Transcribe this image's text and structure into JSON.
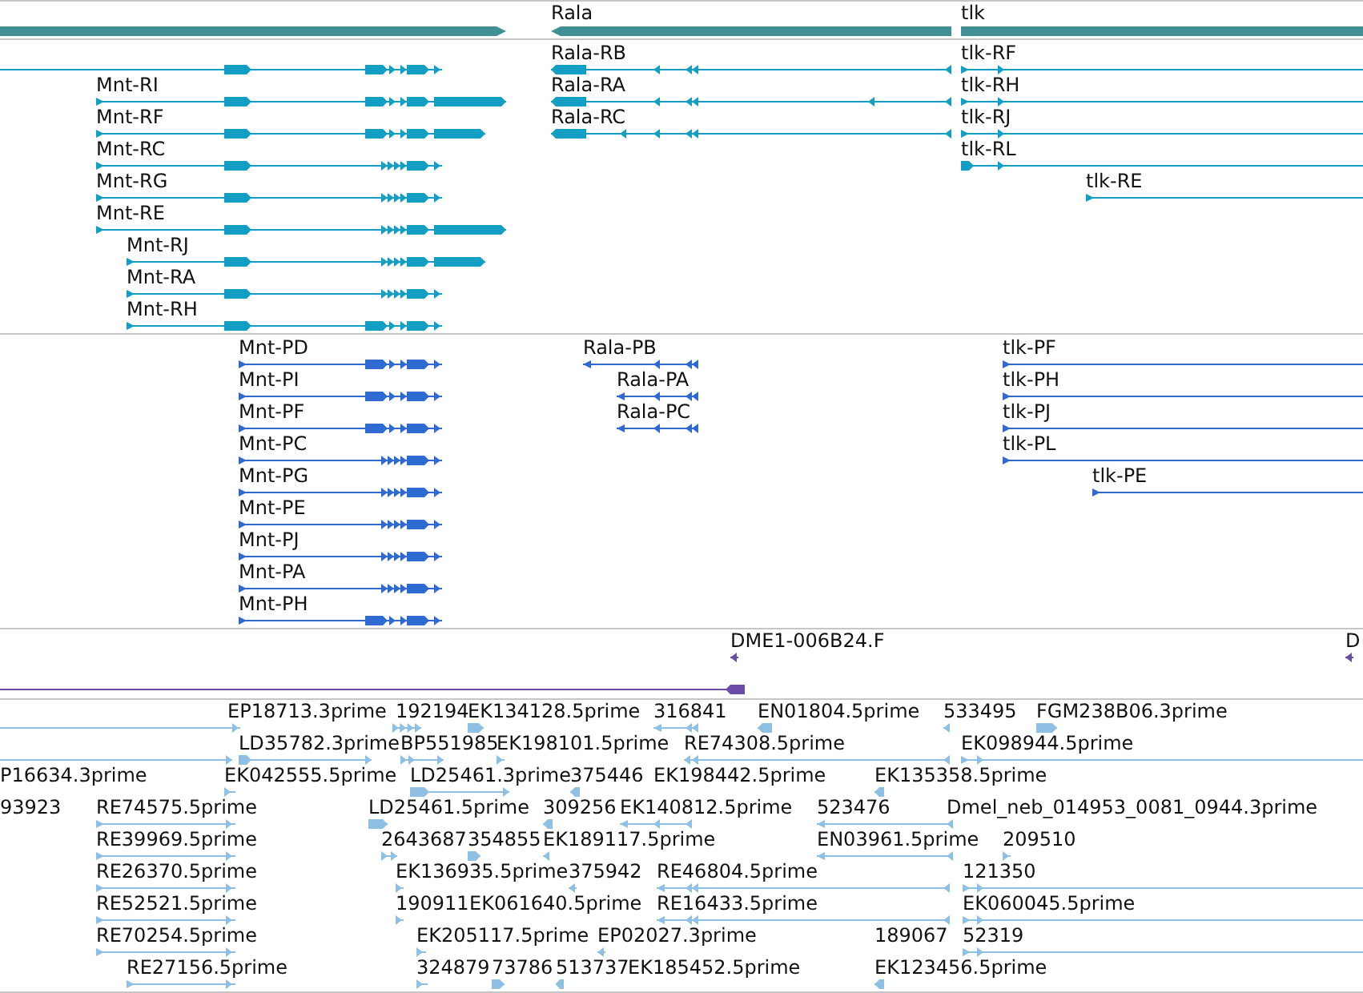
{
  "tracks": [
    {
      "kind": "genes",
      "features": [
        {
          "reverse": false
        },
        {
          "label": "Rala",
          "reverse": true
        },
        {
          "label": "tlk"
        }
      ]
    },
    {
      "kind": "transcripts",
      "features": [
        {
          "reverse": false
        },
        {
          "label": "Rala-RB",
          "reverse": true
        },
        {
          "label": "tlk-RF",
          "reverse": false
        },
        {
          "label": "Mnt-RI",
          "reverse": false
        },
        {
          "label": "Rala-RA",
          "reverse": true
        },
        {
          "label": "tlk-RH",
          "reverse": false
        },
        {
          "label": "Mnt-RF",
          "reverse": false
        },
        {
          "label": "Rala-RC",
          "reverse": true
        },
        {
          "label": "tlk-RJ",
          "reverse": false
        },
        {
          "label": "Mnt-RC",
          "reverse": false
        },
        {
          "label": "tlk-RL",
          "reverse": false
        },
        {
          "label": "Mnt-RG",
          "reverse": false
        },
        {
          "label": "tlk-RE",
          "reverse": false
        },
        {
          "label": "Mnt-RE",
          "reverse": false
        },
        {
          "label": "Mnt-RJ",
          "reverse": false
        },
        {
          "label": "Mnt-RA",
          "reverse": false
        },
        {
          "label": "Mnt-RH",
          "reverse": false
        }
      ]
    },
    {
      "kind": "proteins",
      "features": [
        {
          "label": "Mnt-PD",
          "reverse": false
        },
        {
          "label": "Rala-PB",
          "reverse": true
        },
        {
          "label": "tlk-PF",
          "reverse": false
        },
        {
          "label": "Mnt-PI",
          "reverse": false
        },
        {
          "label": "Rala-PA",
          "reverse": true
        },
        {
          "label": "tlk-PH",
          "reverse": false
        },
        {
          "label": "Mnt-PF",
          "reverse": false
        },
        {
          "label": "Rala-PC",
          "reverse": true
        },
        {
          "label": "tlk-PJ",
          "reverse": false
        },
        {
          "label": "Mnt-PC",
          "reverse": false
        },
        {
          "label": "tlk-PL",
          "reverse": false
        },
        {
          "label": "Mnt-PG",
          "reverse": false
        },
        {
          "label": "tlk-PE",
          "reverse": false
        },
        {
          "label": "Mnt-PE",
          "reverse": false
        },
        {
          "label": "Mnt-PJ",
          "reverse": false
        },
        {
          "label": "Mnt-PA",
          "reverse": false
        },
        {
          "label": "Mnt-PH",
          "reverse": false
        }
      ]
    },
    {
      "kind": "clones",
      "features": [
        {
          "label": "DME1-006B24.F",
          "reverse": true
        },
        {
          "label": "D",
          "reverse": true
        },
        {
          "reverse": true
        }
      ]
    },
    {
      "kind": "ests",
      "features": [
        {
          "reverse": false
        },
        {
          "label": "EP18713.3prime"
        },
        {
          "label": "192194",
          "reverse": false
        },
        {
          "label": "EK134128.5prime",
          "reverse": false
        },
        {
          "label": "316841",
          "reverse": true
        },
        {
          "label": "EN01804.5prime",
          "reverse": true
        },
        {
          "label": "533495",
          "reverse": true
        },
        {
          "label": "FGM238B06.3prime",
          "reverse": false
        },
        {
          "reverse": false
        },
        {
          "label": "LD35782.3prime",
          "reverse": false
        },
        {
          "label": "BP551985",
          "reverse": false
        },
        {
          "label": "EK198101.5prime",
          "reverse": false
        },
        {
          "label": "RE74308.5prime",
          "reverse": true
        },
        {
          "label": "EK098944.5prime",
          "reverse": false
        },
        {
          "label": "P16634.3prime"
        },
        {
          "label": "EK042555.5prime",
          "reverse": false
        },
        {
          "label": "LD25461.3prime",
          "reverse": false
        },
        {
          "label": "375446",
          "reverse": true
        },
        {
          "label": "EK198442.5prime"
        },
        {
          "label": "EK135358.5prime",
          "reverse": true
        },
        {
          "label": "93923"
        },
        {
          "label": "RE74575.5prime",
          "reverse": false
        },
        {
          "label": "LD25461.5prime",
          "reverse": false
        },
        {
          "label": "309256",
          "reverse": true
        },
        {
          "label": "EK140812.5prime",
          "reverse": true
        },
        {
          "label": "523476",
          "reverse": true
        },
        {
          "label": "Dmel_neb_014953_0081_0944.3prime"
        },
        {
          "label": "RE39969.5prime",
          "reverse": false
        },
        {
          "label": "2643687",
          "reverse": false
        },
        {
          "label": "354855",
          "reverse": false
        },
        {
          "label": "EK189117.5prime",
          "reverse": true
        },
        {
          "label": "EN03961.5prime",
          "reverse": true
        },
        {
          "label": "209510",
          "reverse": false
        },
        {
          "label": "RE26370.5prime",
          "reverse": false
        },
        {
          "label": "EK136935.5prime",
          "reverse": false
        },
        {
          "label": "375942",
          "reverse": true
        },
        {
          "label": "RE46804.5prime",
          "reverse": true
        },
        {
          "label": "121350",
          "reverse": false
        },
        {
          "label": "RE52521.5prime",
          "reverse": false
        },
        {
          "label": "190911",
          "reverse": false
        },
        {
          "label": "EK061640.5prime"
        },
        {
          "label": "RE16433.5prime",
          "reverse": true
        },
        {
          "label": "EK060045.5prime",
          "reverse": false
        },
        {
          "label": "RE70254.5prime",
          "reverse": false
        },
        {
          "label": "EK205117.5prime",
          "reverse": false
        },
        {
          "label": "EP02027.3prime",
          "reverse": true
        },
        {
          "label": "189067"
        },
        {
          "label": "52319",
          "reverse": false
        },
        {
          "label": "RE27156.5prime",
          "reverse": false
        },
        {
          "label": "324879",
          "reverse": false
        },
        {
          "label": "73786",
          "reverse": false
        },
        {
          "label": "513737",
          "reverse": true
        },
        {
          "label": "EK185452.5prime"
        },
        {
          "label": "EK123456.5prime",
          "reverse": true
        }
      ]
    }
  ]
}
